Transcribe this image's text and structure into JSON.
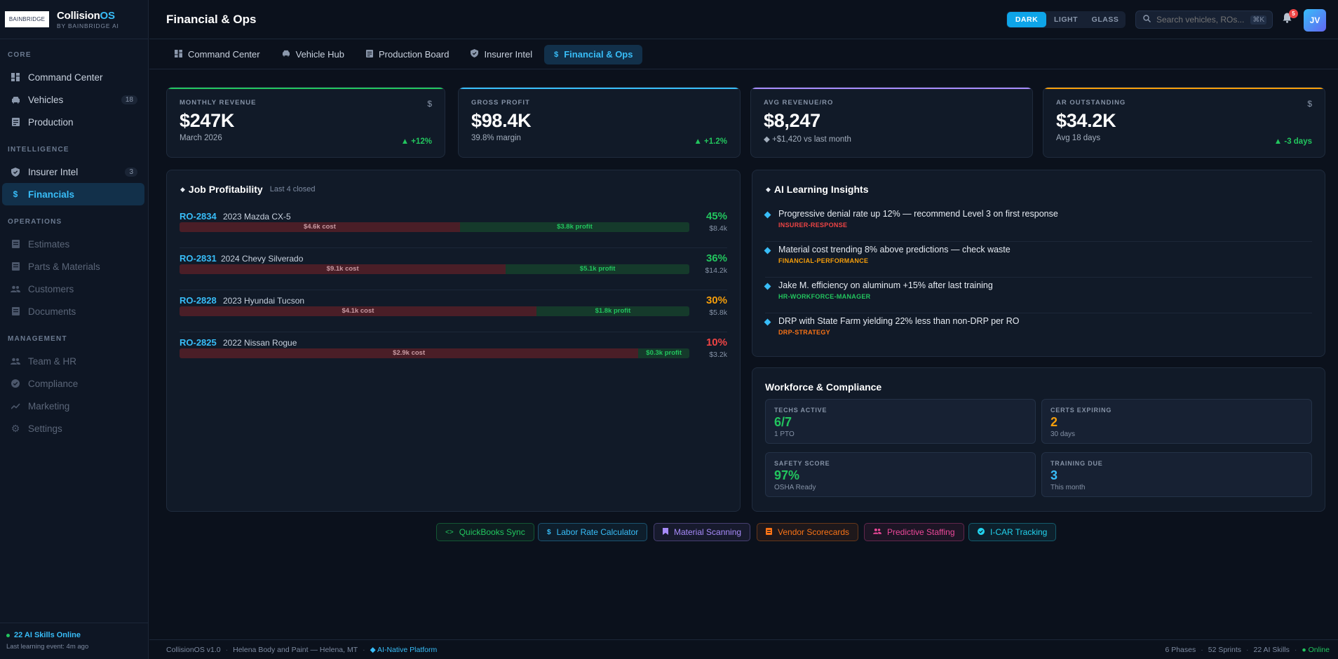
{
  "brand": {
    "logo": "BAINBRIDGE",
    "name_a": "Collision",
    "name_b": "OS",
    "sub": "BY BAINBRIDGE AI"
  },
  "sidebar": {
    "sections": [
      {
        "title": "CORE",
        "items": [
          {
            "label": "Command Center",
            "icon": "dashboard-icon"
          },
          {
            "label": "Vehicles",
            "icon": "car-icon",
            "badge": "18"
          },
          {
            "label": "Production",
            "icon": "board-icon"
          }
        ]
      },
      {
        "title": "INTELLIGENCE",
        "items": [
          {
            "label": "Insurer Intel",
            "icon": "shield-icon",
            "badge": "3"
          },
          {
            "label": "Financials",
            "icon": "dollar-icon"
          }
        ]
      },
      {
        "title": "OPERATIONS",
        "items": [
          {
            "label": "Estimates",
            "icon": "doc-icon"
          },
          {
            "label": "Parts & Materials",
            "icon": "doc-icon"
          },
          {
            "label": "Customers",
            "icon": "people-icon"
          },
          {
            "label": "Documents",
            "icon": "doc-icon"
          }
        ]
      },
      {
        "title": "MANAGEMENT",
        "items": [
          {
            "label": "Team & HR",
            "icon": "people-icon"
          },
          {
            "label": "Compliance",
            "icon": "check-icon"
          },
          {
            "label": "Marketing",
            "icon": "trend-icon"
          },
          {
            "label": "Settings",
            "icon": "gear-icon"
          }
        ]
      }
    ],
    "footer": {
      "skills": "22 AI Skills Online",
      "learning": "Last learning event: 4m ago"
    }
  },
  "header": {
    "title": "Financial & Ops",
    "themes": [
      "DARK",
      "LIGHT",
      "GLASS"
    ],
    "search_placeholder": "Search vehicles, ROs...",
    "search_kbd": "⌘K",
    "notifications": "5",
    "avatar": "JV"
  },
  "tabs": [
    {
      "label": "Command Center",
      "icon": "dashboard-icon"
    },
    {
      "label": "Vehicle Hub",
      "icon": "car-icon"
    },
    {
      "label": "Production Board",
      "icon": "board-icon"
    },
    {
      "label": "Insurer Intel",
      "icon": "shield-icon"
    },
    {
      "label": "Financial & Ops",
      "icon": "dollar-icon"
    }
  ],
  "kpis": [
    {
      "label": "MONTHLY REVENUE",
      "value": "$247K",
      "sub": "March 2026",
      "delta": "▲ +12%",
      "icon": "$",
      "color": "#22c55e"
    },
    {
      "label": "GROSS PROFIT",
      "value": "$98.4K",
      "sub": "39.8% margin",
      "delta": "▲ +1.2%",
      "icon": "",
      "color": "#38bdf8"
    },
    {
      "label": "AVG REVENUE/RO",
      "value": "$8,247",
      "sub": "◆ +$1,420 vs last month",
      "delta": "",
      "icon": "",
      "color": "#a78bfa"
    },
    {
      "label": "AR OUTSTANDING",
      "value": "$34.2K",
      "sub": "Avg 18 days",
      "delta": "▲ -3 days",
      "icon": "$",
      "color": "#f59e0b"
    }
  ],
  "jobs": {
    "title": "Job Profitability",
    "subtitle": "Last 4 closed",
    "items": [
      {
        "ro": "RO-2834",
        "vehicle": "2023 Mazda CX-5",
        "pct": "45%",
        "pct_color": "#22c55e",
        "cost": "$4.6k cost",
        "profit": "$3.8k profit",
        "total": "$8.4k",
        "cost_share": 0.55
      },
      {
        "ro": "RO-2831",
        "vehicle": "2024 Chevy Silverado",
        "pct": "36%",
        "pct_color": "#22c55e",
        "cost": "$9.1k cost",
        "profit": "$5.1k profit",
        "total": "$14.2k",
        "cost_share": 0.64
      },
      {
        "ro": "RO-2828",
        "vehicle": "2023 Hyundai Tucson",
        "pct": "30%",
        "pct_color": "#f59e0b",
        "cost": "$4.1k cost",
        "profit": "$1.8k profit",
        "total": "$5.8k",
        "cost_share": 0.7
      },
      {
        "ro": "RO-2825",
        "vehicle": "2022 Nissan Rogue",
        "pct": "10%",
        "pct_color": "#ef4444",
        "cost": "$2.9k cost",
        "profit": "$0.3k profit",
        "total": "$3.2k",
        "cost_share": 0.9
      }
    ]
  },
  "insights": {
    "title": "AI Learning Insights",
    "items": [
      {
        "text": "Progressive denial rate up 12% — recommend Level 3 on first response",
        "tag": "INSURER-RESPONSE",
        "color": "#ef4444"
      },
      {
        "text": "Material cost trending 8% above predictions — check waste",
        "tag": "FINANCIAL-PERFORMANCE",
        "color": "#f59e0b"
      },
      {
        "text": "Jake M. efficiency on aluminum +15% after last training",
        "tag": "HR-WORKFORCE-MANAGER",
        "color": "#22c55e"
      },
      {
        "text": "DRP with State Farm yielding 22% less than non-DRP per RO",
        "tag": "DRP-STRATEGY",
        "color": "#f97316"
      }
    ]
  },
  "workforce": {
    "title": "Workforce & Compliance",
    "cards": [
      {
        "label": "TECHS ACTIVE",
        "value": "6/7",
        "sub": "1 PTO",
        "color": "#22c55e"
      },
      {
        "label": "CERTS EXPIRING",
        "value": "2",
        "sub": "30 days",
        "color": "#f59e0b"
      },
      {
        "label": "SAFETY SCORE",
        "value": "97%",
        "sub": "OSHA Ready",
        "color": "#22c55e"
      },
      {
        "label": "TRAINING DUE",
        "value": "3",
        "sub": "This month",
        "color": "#38bdf8"
      }
    ]
  },
  "quick_links": [
    {
      "label": "QuickBooks Sync",
      "icon": "code-icon",
      "color": "#22c55e"
    },
    {
      "label": "Labor Rate Calculator",
      "icon": "dollar-icon",
      "color": "#38bdf8"
    },
    {
      "label": "Material Scanning",
      "icon": "bookmark-icon",
      "color": "#a78bfa"
    },
    {
      "label": "Vendor Scorecards",
      "icon": "card-icon",
      "color": "#f97316"
    },
    {
      "label": "Predictive Staffing",
      "icon": "people-icon",
      "color": "#ec4899"
    },
    {
      "label": "I-CAR Tracking",
      "icon": "check-icon",
      "color": "#22d3ee"
    }
  ],
  "footer": {
    "version": "CollisionOS v1.0",
    "shop": "Helena Body and Paint — Helena, MT",
    "platform": "◆ AI-Native Platform",
    "phases": "6 Phases",
    "sprints": "52 Sprints",
    "skills": "22 AI Skills",
    "status": "● Online"
  }
}
